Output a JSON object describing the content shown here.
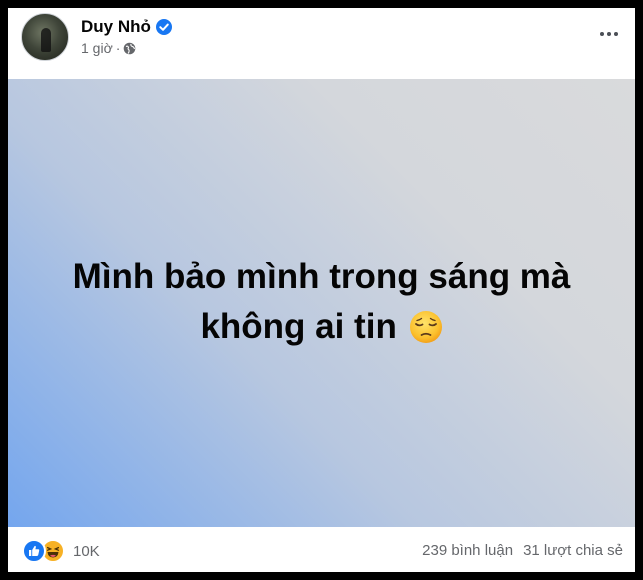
{
  "post": {
    "author": "Duy Nhỏ",
    "time": "1 giờ",
    "separator": "·",
    "content_line1": "Mình bảo mình trong sáng mà",
    "content_line2": "không ai tin"
  },
  "icons": {
    "verified": "verified-badge-icon",
    "privacy": "globe-icon",
    "more": "more-options-icon",
    "emoji": "pensive-face-emoji",
    "reaction_1": "like-icon",
    "reaction_2": "haha-icon"
  },
  "reactions": {
    "count": "10K"
  },
  "stats": {
    "comments": "239 bình luận",
    "shares": "31 lượt chia sẻ"
  },
  "colors": {
    "accent": "#1877f2",
    "haha": "#f7b125",
    "background_gradient_start": "#74a6ee",
    "background_gradient_end": "#d9dadc",
    "muted_text": "#65676b"
  }
}
